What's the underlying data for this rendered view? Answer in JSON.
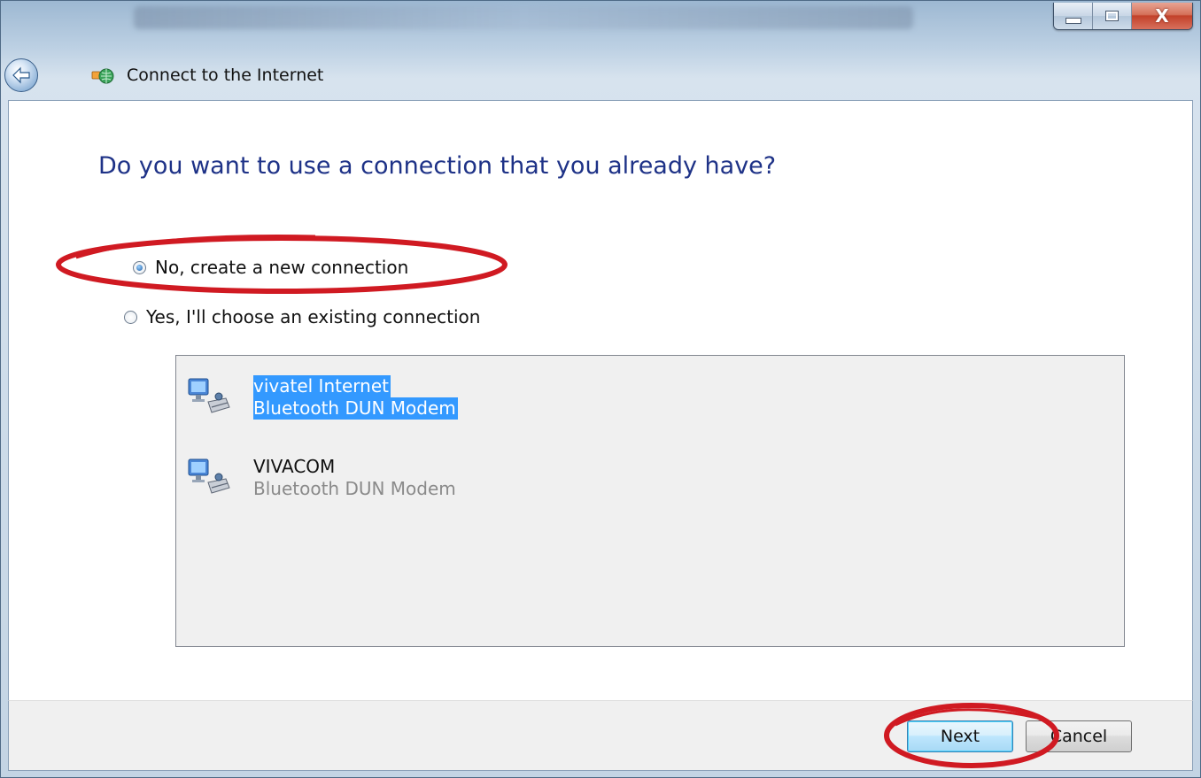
{
  "window": {
    "title": "Connect to the Internet",
    "controls": {
      "minimize_icon": "minimize-icon",
      "maximize_icon": "maximize-icon",
      "close_icon": "close-icon",
      "close_glyph": "X"
    },
    "back_icon": "back-arrow-icon",
    "app_icon": "network-globe-icon"
  },
  "main": {
    "question": "Do you want to use a connection that you already have?",
    "options": [
      {
        "label": "No, create a new connection",
        "selected": true
      },
      {
        "label": "Yes, I'll choose an existing connection",
        "selected": false
      }
    ],
    "connections": [
      {
        "name": "vivatel Internet",
        "type": "Bluetooth DUN Modem",
        "selected": true,
        "icon": "network-modem-icon"
      },
      {
        "name": "VIVACOM",
        "type": "Bluetooth DUN Modem",
        "selected": false,
        "icon": "network-modem-icon"
      }
    ]
  },
  "footer": {
    "next_label": "Next",
    "cancel_label": "Cancel"
  },
  "colors": {
    "heading": "#1e3287",
    "selection": "#3399ff",
    "annotation": "#d01a22"
  }
}
